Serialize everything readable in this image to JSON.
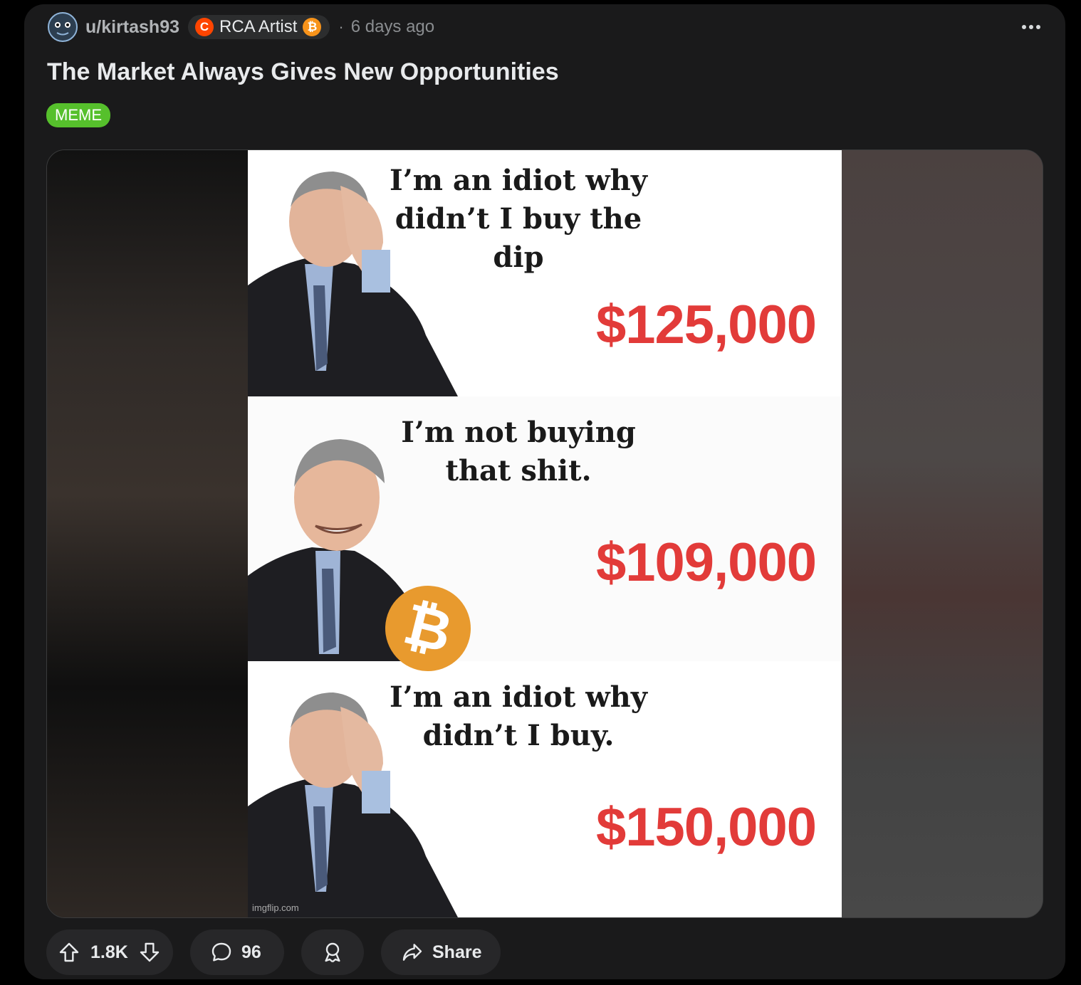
{
  "post": {
    "username": "u/kirtash93",
    "user_flair": "RCA Artist",
    "separator": "·",
    "time_ago": "6 days ago",
    "title": "The Market Always Gives New Opportunities",
    "post_flair": "MEME",
    "flair_color": "#56c02c"
  },
  "meme": {
    "panels": [
      {
        "caption": "I’m an idiot why didn’t I buy the dip",
        "price": "$125,000"
      },
      {
        "caption": "I’m not buying that shit.",
        "price": "$109,000"
      },
      {
        "caption": "I’m an idiot why didn’t I buy.",
        "price": "$150,000"
      }
    ],
    "watermark": "imgflip.com",
    "bitcoin_symbol": "₿"
  },
  "actions": {
    "vote_count": "1.8K",
    "comment_count": "96",
    "share_label": "Share"
  },
  "icons": [
    "avatar-icon",
    "moons-icon",
    "bitcoin-icon",
    "more-options-icon",
    "upvote-icon",
    "downvote-icon",
    "comment-icon",
    "award-icon",
    "share-icon"
  ],
  "colors": {
    "background": "#1a1a1b",
    "price_red": "#e23b39",
    "bitcoin_orange": "#f7931a",
    "moons_orange": "#ff4500"
  }
}
